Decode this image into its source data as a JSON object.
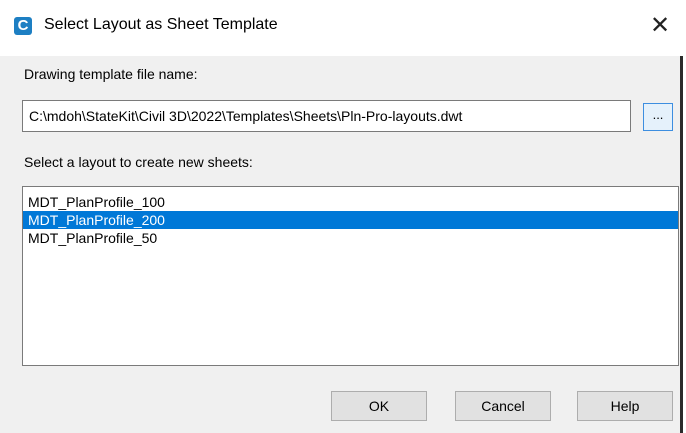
{
  "window": {
    "title": "Select Layout as Sheet Template",
    "app_icon_letter": "C",
    "close_glyph": "✕"
  },
  "form": {
    "file_label": "Drawing template file name:",
    "file_value": "C:\\mdoh\\StateKit\\Civil 3D\\2022\\Templates\\Sheets\\Pln-Pro-layouts.dwt",
    "browse_label": "...",
    "layout_label": "Select a layout to create new sheets:"
  },
  "layouts": {
    "items": [
      {
        "label": "MDT_PlanProfile_100",
        "selected": false
      },
      {
        "label": "MDT_PlanProfile_200",
        "selected": true
      },
      {
        "label": "MDT_PlanProfile_50",
        "selected": false
      }
    ]
  },
  "buttons": {
    "ok": "OK",
    "cancel": "Cancel",
    "help": "Help"
  },
  "colors": {
    "selection": "#0078d7",
    "app_icon": "#1d7fc3"
  }
}
